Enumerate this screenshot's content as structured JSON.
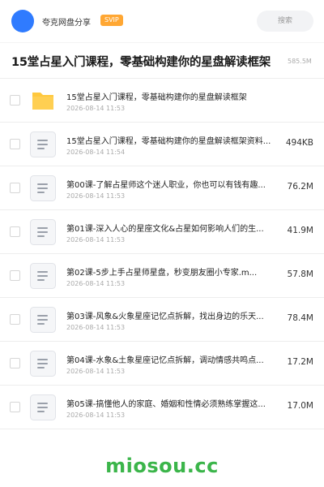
{
  "header": {
    "app_name": "夸克网盘分享",
    "badge": "SVIP",
    "search_label": "搜索"
  },
  "title_row": {
    "title": "15堂占星入门课程，零基础构建你的星盘解读框架",
    "size": "585.5M"
  },
  "files": [
    {
      "type": "folder",
      "icon": "folder-icon",
      "name": "15堂占星入门课程，零基础构建你的星盘解读框架",
      "date": "2026-08-14 11:53",
      "size": ""
    },
    {
      "type": "file",
      "icon": "document-icon",
      "name": "15堂占星入门课程，零基础构建你的星盘解读框架资料...",
      "date": "2026-08-14 11:54",
      "size": "494KB"
    },
    {
      "type": "file",
      "icon": "document-icon",
      "name": "第00课-了解占星师这个迷人职业，你也可以有钱有趣...",
      "date": "2026-08-14 11:53",
      "size": "76.2M"
    },
    {
      "type": "file",
      "icon": "document-icon",
      "name": "第01课-深入人心的星座文化&占星如何影响人们的生...",
      "date": "2026-08-14 11:53",
      "size": "41.9M"
    },
    {
      "type": "file",
      "icon": "document-icon",
      "name": "第02课-5步上手占星师星盘，秒变朋友圈小专家.m...",
      "date": "2026-08-14 11:53",
      "size": "57.8M"
    },
    {
      "type": "file",
      "icon": "document-icon",
      "name": "第03课-风象&火象星座记忆点拆解，找出身边的乐天...",
      "date": "2026-08-14 11:53",
      "size": "78.4M"
    },
    {
      "type": "file",
      "icon": "document-icon",
      "name": "第04课-水象&土象星座记忆点拆解，调动情感共鸣点...",
      "date": "2026-08-14 11:53",
      "size": "17.2M"
    },
    {
      "type": "file",
      "icon": "document-icon",
      "name": "第05课-搞懂他人的家庭、婚姻和性情必须熟练掌握这...",
      "date": "2026-08-14 11:53",
      "size": "17.0M"
    }
  ],
  "watermark": "miosou.cc",
  "colors": {
    "accent_blue": "#2f7bff",
    "svip_orange": "#ffa733",
    "folder_yellow": "#ffc83d",
    "watermark_green": "#3bb54a"
  }
}
